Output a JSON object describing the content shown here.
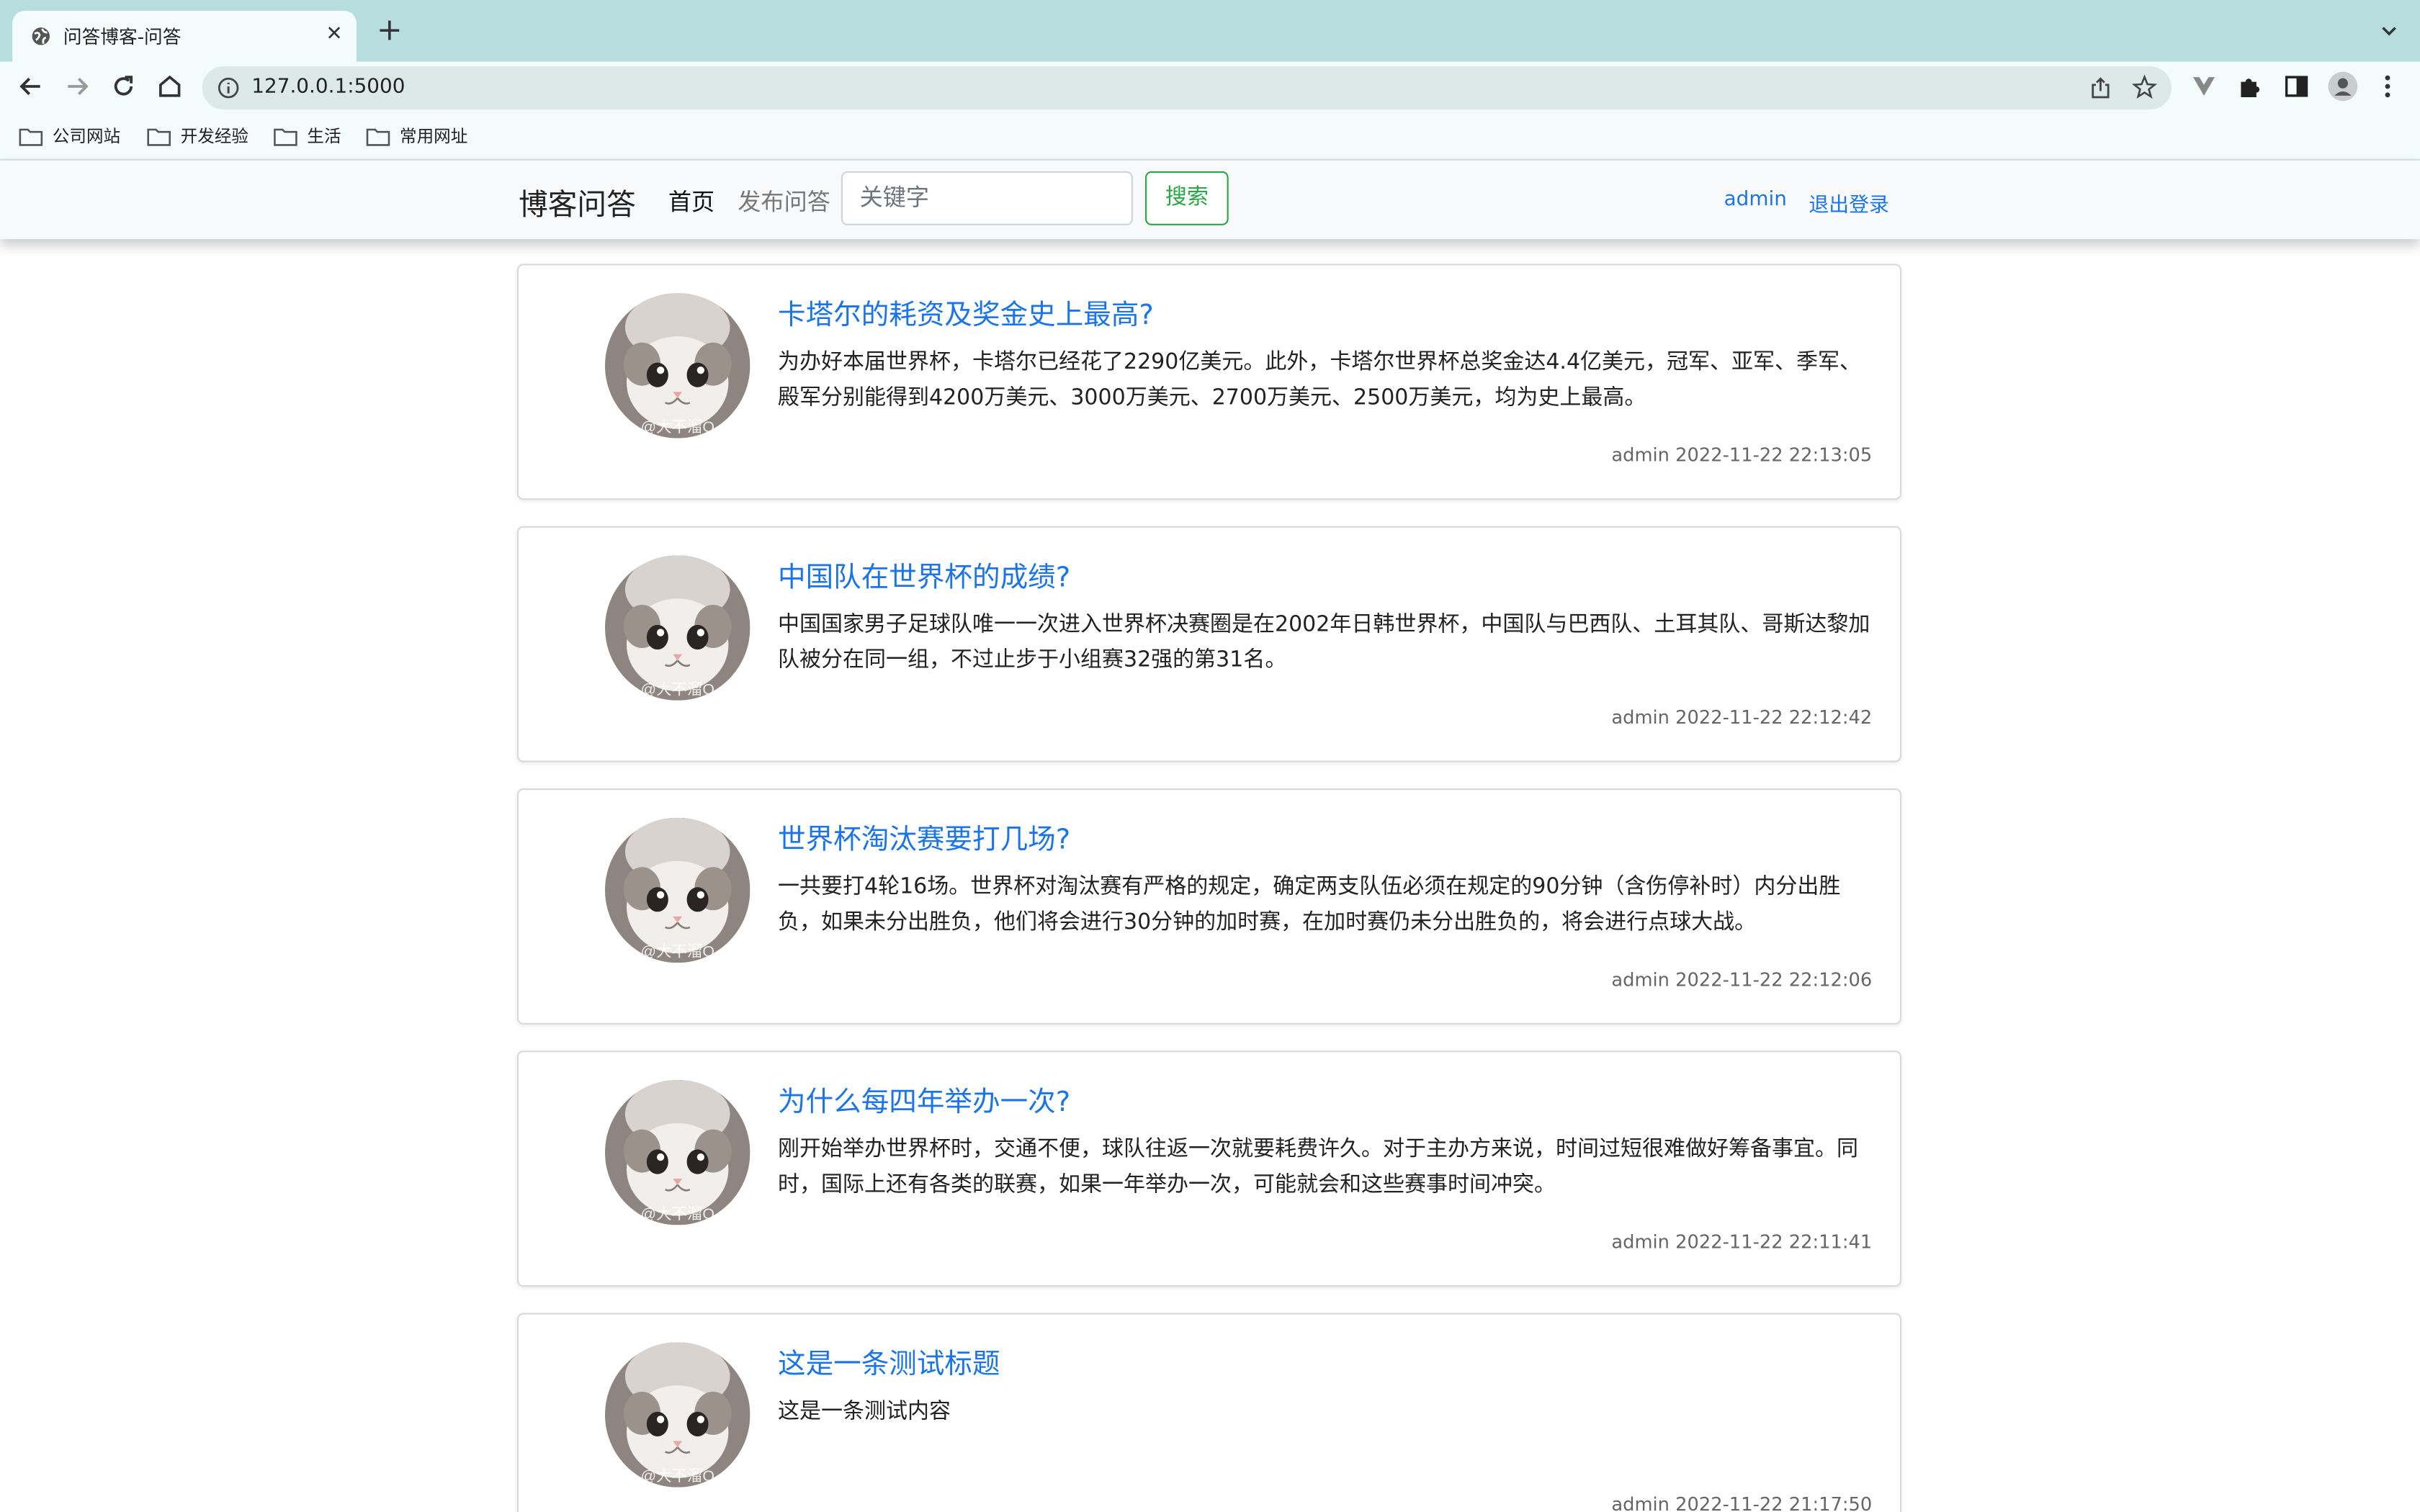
{
  "browser": {
    "tab_title": "问答博客-问答",
    "url": "127.0.0.1:5000",
    "bookmarks": [
      "公司网站",
      "开发经验",
      "生活",
      "常用网址"
    ]
  },
  "navbar": {
    "brand": "博客问答",
    "home": "首页",
    "publish": "发布问答",
    "search_placeholder": "关键字",
    "search_button": "搜索",
    "user": "admin",
    "logout": "退出登录"
  },
  "avatar_watermark": "@大不溜O",
  "questions": [
    {
      "title": "卡塔尔的耗资及奖金史上最高?",
      "content": "为办好本届世界杯，卡塔尔已经花了2290亿美元。此外，卡塔尔世界杯总奖金达4.4亿美元，冠军、亚军、季军、殿军分别能得到4200万美元、3000万美元、2700万美元、2500万美元，均为史上最高。",
      "meta": "admin 2022-11-22 22:13:05"
    },
    {
      "title": "中国队在世界杯的成绩?",
      "content": "中国国家男子足球队唯一一次进入世界杯决赛圈是在2002年日韩世界杯，中国队与巴西队、土耳其队、哥斯达黎加队被分在同一组，不过止步于小组赛32强的第31名。",
      "meta": "admin 2022-11-22 22:12:42"
    },
    {
      "title": "世界杯淘汰赛要打几场?",
      "content": "一共要打4轮16场。世界杯对淘汰赛有严格的规定，确定两支队伍必须在规定的90分钟（含伤停补时）内分出胜负，如果未分出胜负，他们将会进行30分钟的加时赛，在加时赛仍未分出胜负的，将会进行点球大战。",
      "meta": "admin 2022-11-22 22:12:06"
    },
    {
      "title": "为什么每四年举办一次?",
      "content": "刚开始举办世界杯时，交通不便，球队往返一次就要耗费许久。对于主办方来说，时间过短很难做好筹备事宜。同时，国际上还有各类的联赛，如果一年举办一次，可能就会和这些赛事时间冲突。",
      "meta": "admin 2022-11-22 22:11:41"
    },
    {
      "title": "这是一条测试标题",
      "content": "这是一条测试内容",
      "meta": "admin 2022-11-22 21:17:50"
    }
  ]
}
